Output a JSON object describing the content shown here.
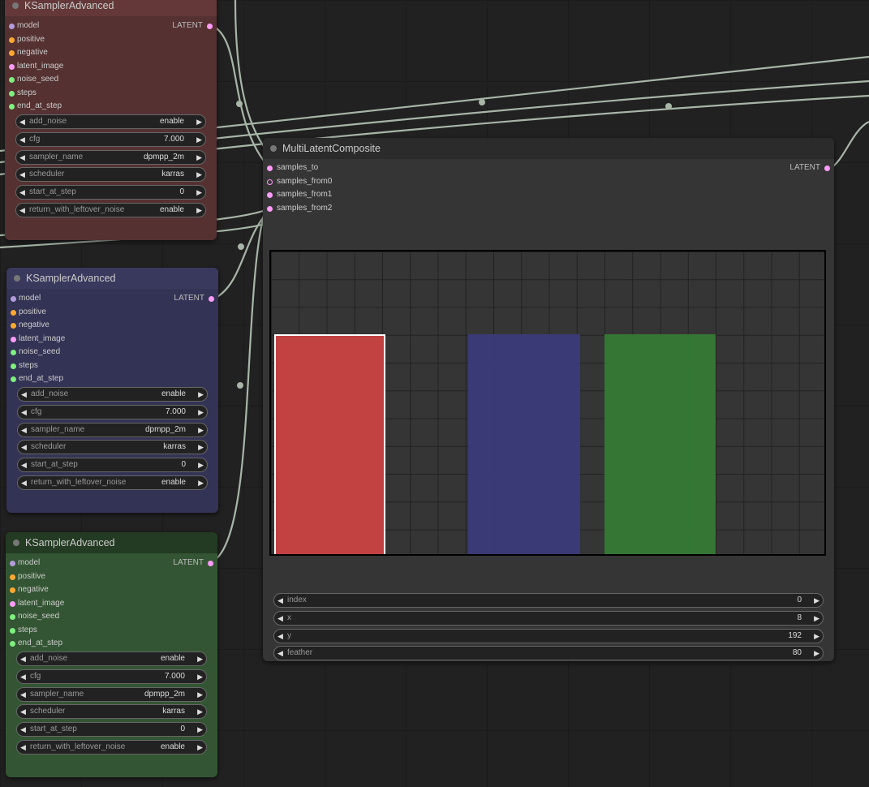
{
  "colors": {
    "canvas": "#212121",
    "wire": "#a7b6a7",
    "slot_model": "#b39ddb",
    "slot_conditioning": "#ffa931",
    "slot_latent": "#ff9cf9",
    "slot_int": "#7ff07f",
    "rect_red": "#c24141",
    "rect_blue": "#3b3b7a",
    "rect_green": "#367a36"
  },
  "sampler_node": {
    "title": "KSamplerAdvanced",
    "output_label": "LATENT",
    "inputs": [
      {
        "label": "model",
        "type": "MODEL"
      },
      {
        "label": "positive",
        "type": "CONDITIONING"
      },
      {
        "label": "negative",
        "type": "CONDITIONING"
      },
      {
        "label": "latent_image",
        "type": "LATENT"
      },
      {
        "label": "noise_seed",
        "type": "INT"
      },
      {
        "label": "steps",
        "type": "INT"
      },
      {
        "label": "end_at_step",
        "type": "INT"
      }
    ],
    "widgets": [
      {
        "label": "add_noise",
        "value": "enable"
      },
      {
        "label": "cfg",
        "value": "7.000"
      },
      {
        "label": "sampler_name",
        "value": "dpmpp_2m"
      },
      {
        "label": "scheduler",
        "value": "karras"
      },
      {
        "label": "start_at_step",
        "value": "0"
      },
      {
        "label": "return_with_leftover_noise",
        "value": "enable"
      }
    ]
  },
  "composite_node": {
    "title": "MultiLatentComposite",
    "output_label": "LATENT",
    "inputs": [
      {
        "label": "samples_to",
        "connected": true
      },
      {
        "label": "samples_from0",
        "connected": false
      },
      {
        "label": "samples_from1",
        "connected": true
      },
      {
        "label": "samples_from2",
        "connected": true
      }
    ],
    "widgets": [
      {
        "label": "index",
        "value": "0"
      },
      {
        "label": "x",
        "value": "8"
      },
      {
        "label": "y",
        "value": "192"
      },
      {
        "label": "feather",
        "value": "80"
      }
    ],
    "arrow_left": "◀",
    "arrow_right": "▶"
  }
}
